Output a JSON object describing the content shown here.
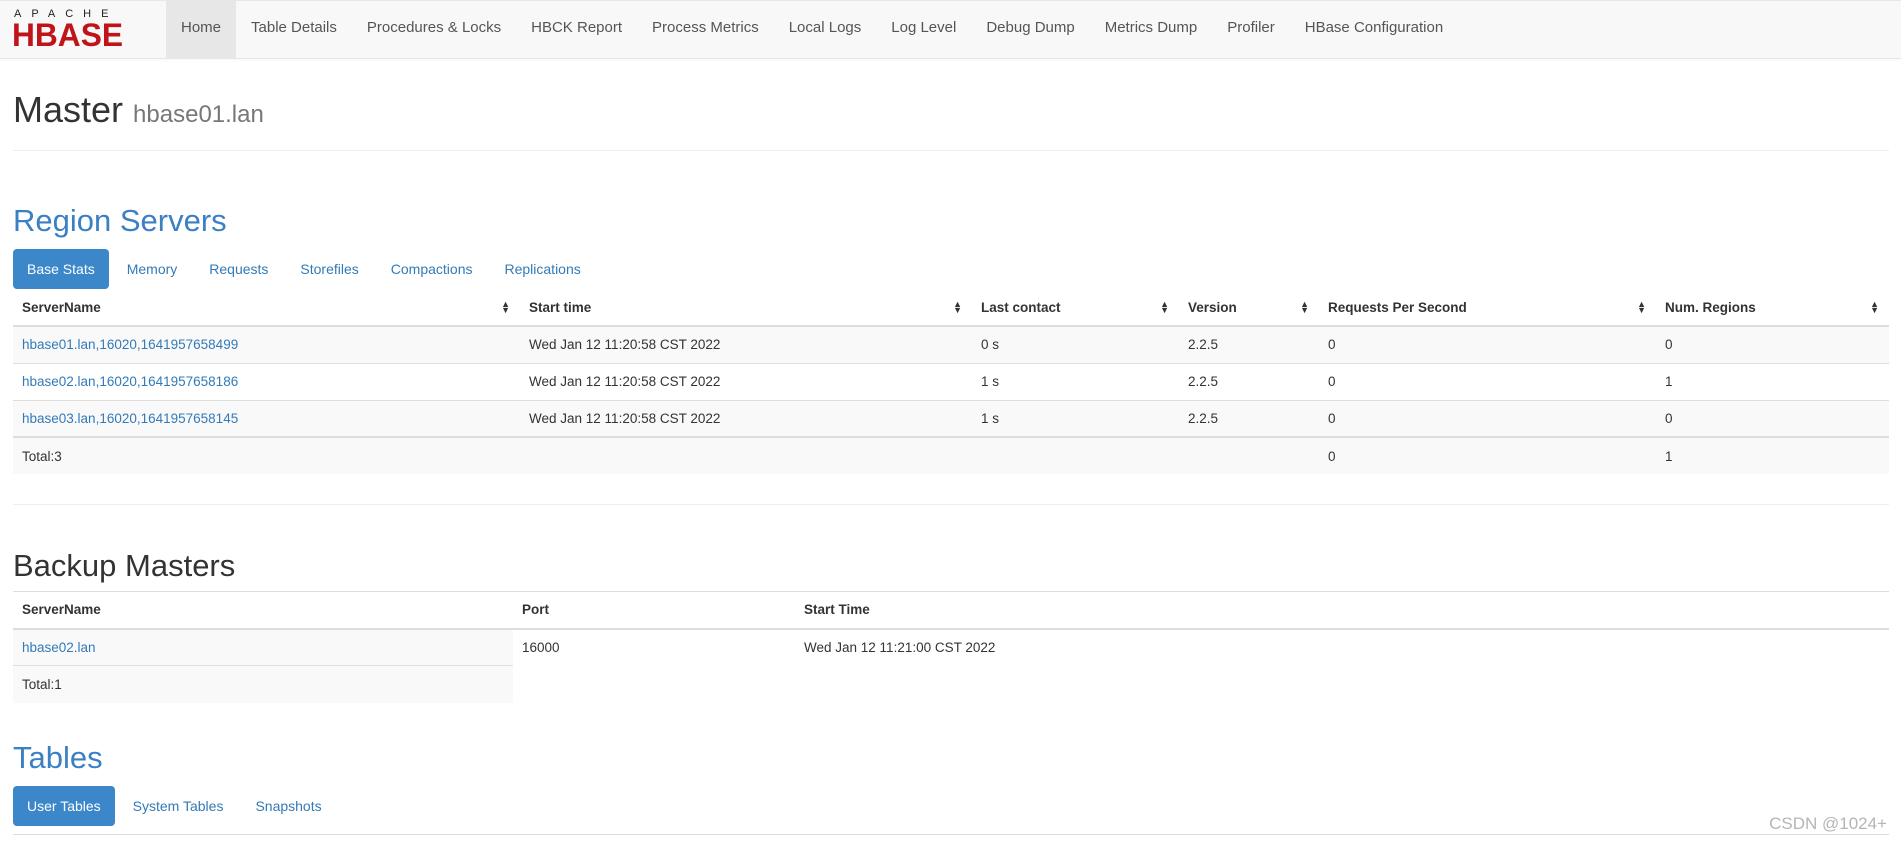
{
  "brand": {
    "top": "APACHE",
    "main": "HBASE"
  },
  "nav": [
    "Home",
    "Table Details",
    "Procedures & Locks",
    "HBCK Report",
    "Process Metrics",
    "Local Logs",
    "Log Level",
    "Debug Dump",
    "Metrics Dump",
    "Profiler",
    "HBase Configuration"
  ],
  "page": {
    "title": "Master",
    "host": "hbase01.lan"
  },
  "region_servers": {
    "heading": "Region Servers",
    "tabs": [
      "Base Stats",
      "Memory",
      "Requests",
      "Storefiles",
      "Compactions",
      "Replications"
    ],
    "columns": [
      "ServerName",
      "Start time",
      "Last contact",
      "Version",
      "Requests Per Second",
      "Num. Regions"
    ],
    "rows": [
      [
        "hbase01.lan,16020,1641957658499",
        "Wed Jan 12 11:20:58 CST 2022",
        "0 s",
        "2.2.5",
        "0",
        "0"
      ],
      [
        "hbase02.lan,16020,1641957658186",
        "Wed Jan 12 11:20:58 CST 2022",
        "1 s",
        "2.2.5",
        "0",
        "1"
      ],
      [
        "hbase03.lan,16020,1641957658145",
        "Wed Jan 12 11:20:58 CST 2022",
        "1 s",
        "2.2.5",
        "0",
        "0"
      ]
    ],
    "total": {
      "label": "Total:3",
      "requests": "0",
      "regions": "1"
    }
  },
  "backup_masters": {
    "heading": "Backup Masters",
    "columns": [
      "ServerName",
      "Port",
      "Start Time"
    ],
    "rows": [
      [
        "hbase02.lan",
        "16000",
        "Wed Jan 12 11:21:00 CST 2022"
      ]
    ],
    "total": "Total:1"
  },
  "tables": {
    "heading": "Tables",
    "tabs": [
      "User Tables",
      "System Tables",
      "Snapshots"
    ]
  },
  "watermark": "CSDN @1024+"
}
